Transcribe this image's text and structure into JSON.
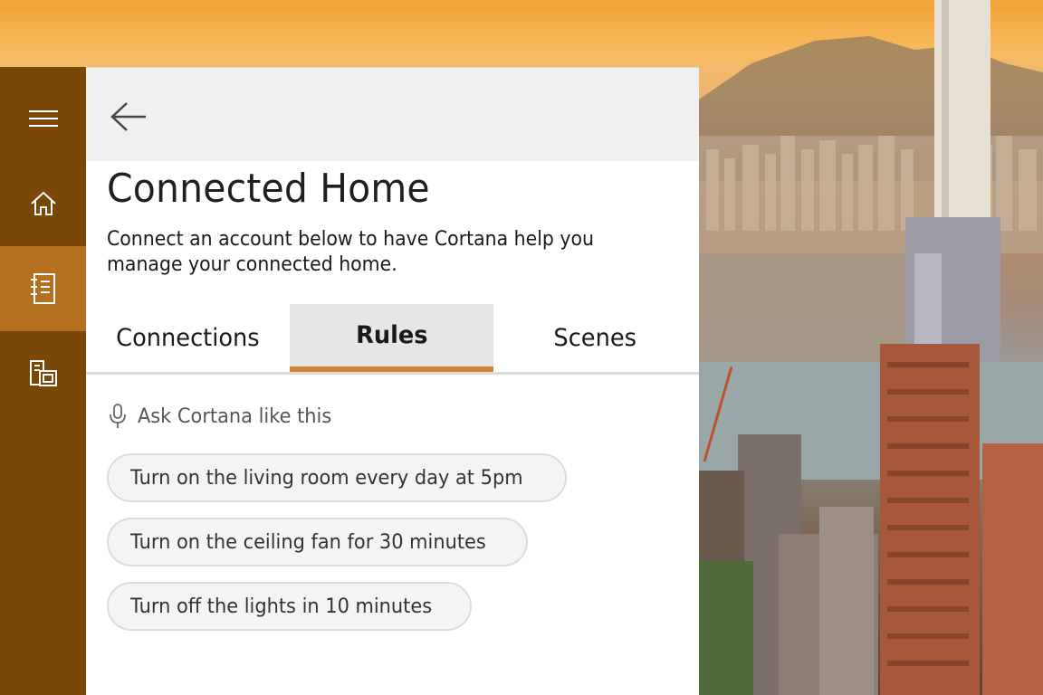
{
  "nav": {
    "items": [
      {
        "icon": "hamburger-icon",
        "active": false
      },
      {
        "icon": "home-icon",
        "active": false
      },
      {
        "icon": "notebook-icon",
        "active": true
      },
      {
        "icon": "devices-icon",
        "active": false
      }
    ]
  },
  "header": {
    "back_icon": "back-arrow-icon",
    "title": "Connected Home",
    "description": "Connect an account below to have Cortana help you manage your connected home."
  },
  "tabs": [
    {
      "label": "Connections",
      "active": false
    },
    {
      "label": "Rules",
      "active": true
    },
    {
      "label": "Scenes",
      "active": false
    }
  ],
  "ask": {
    "icon": "microphone-icon",
    "label": "Ask Cortana like this"
  },
  "suggestions": [
    "Turn on the living room every day at 5pm",
    "Turn on the ceiling fan for 30 minutes",
    "Turn off the lights in 10 minutes"
  ],
  "colors": {
    "rail": "#7a4708",
    "rail_active": "#b5701f",
    "accent": "#d0842d"
  }
}
